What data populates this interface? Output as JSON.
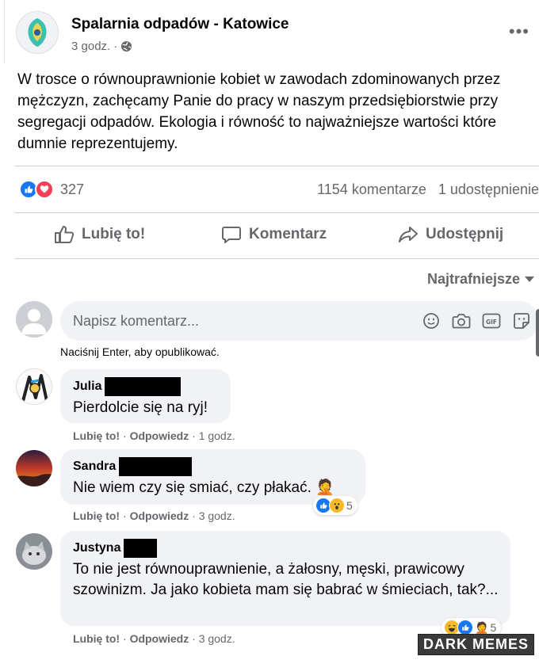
{
  "post": {
    "page_name": "Spalarnia odpadów - Katowice",
    "time": "3 godz.",
    "audience_icon": "globe-icon",
    "more_icon": "more-options-icon",
    "text": "W trosce o równouprawnionie kobiet w zawodach zdominowanych przez mężczyzn, zachęcamy Panie do pracy w naszym przedsiębiorstwie przy segregacji odpadów. Ekologia i równość to najważniejsze wartości które dumnie reprezentujemy."
  },
  "stats": {
    "reaction_count": "327",
    "comments": "1154 komentarze",
    "shares": "1 udostępnienie",
    "reaction_icons": [
      "like",
      "love"
    ]
  },
  "actions": {
    "like": "Lubię to!",
    "comment": "Komentarz",
    "share": "Udostępnij"
  },
  "sort": {
    "label": "Najtrafniejsze"
  },
  "composer": {
    "placeholder": "Napisz komentarz...",
    "icons": [
      "emoji-icon",
      "camera-icon",
      "gif-icon",
      "sticker-icon"
    ],
    "hint": "Naciśnij Enter, aby opublikować."
  },
  "comments": [
    {
      "author": "Julia",
      "text": "Pierdolcie się na ryj!",
      "like": "Lubię to!",
      "reply": "Odpowiedz",
      "time": "1 godz."
    },
    {
      "author": "Sandra",
      "text": "Nie wiem czy się smiać, czy płakać. 🤦",
      "like": "Lubię to!",
      "reply": "Odpowiedz",
      "time": "3 godz.",
      "reaction_count": "5",
      "reaction_icons": [
        "like",
        "wow"
      ]
    },
    {
      "author": "Justyna",
      "text": "To nie jest równouprawnienie, a żałosny, męski, prawicowy szowinizm. Ja jako kobieta mam się babrać w śmieciach, tak?...",
      "like": "Lubię to!",
      "reply": "Odpowiedz",
      "time": "3 godz.",
      "reaction_count": "5",
      "reaction_icons": [
        "haha",
        "like",
        "facepalm"
      ]
    }
  ],
  "watermark": "DARK MEMES",
  "colors": {
    "accent": "#1877f2",
    "love": "#f33e58",
    "bubble": "#f0f2f5",
    "muted": "#65676b"
  }
}
